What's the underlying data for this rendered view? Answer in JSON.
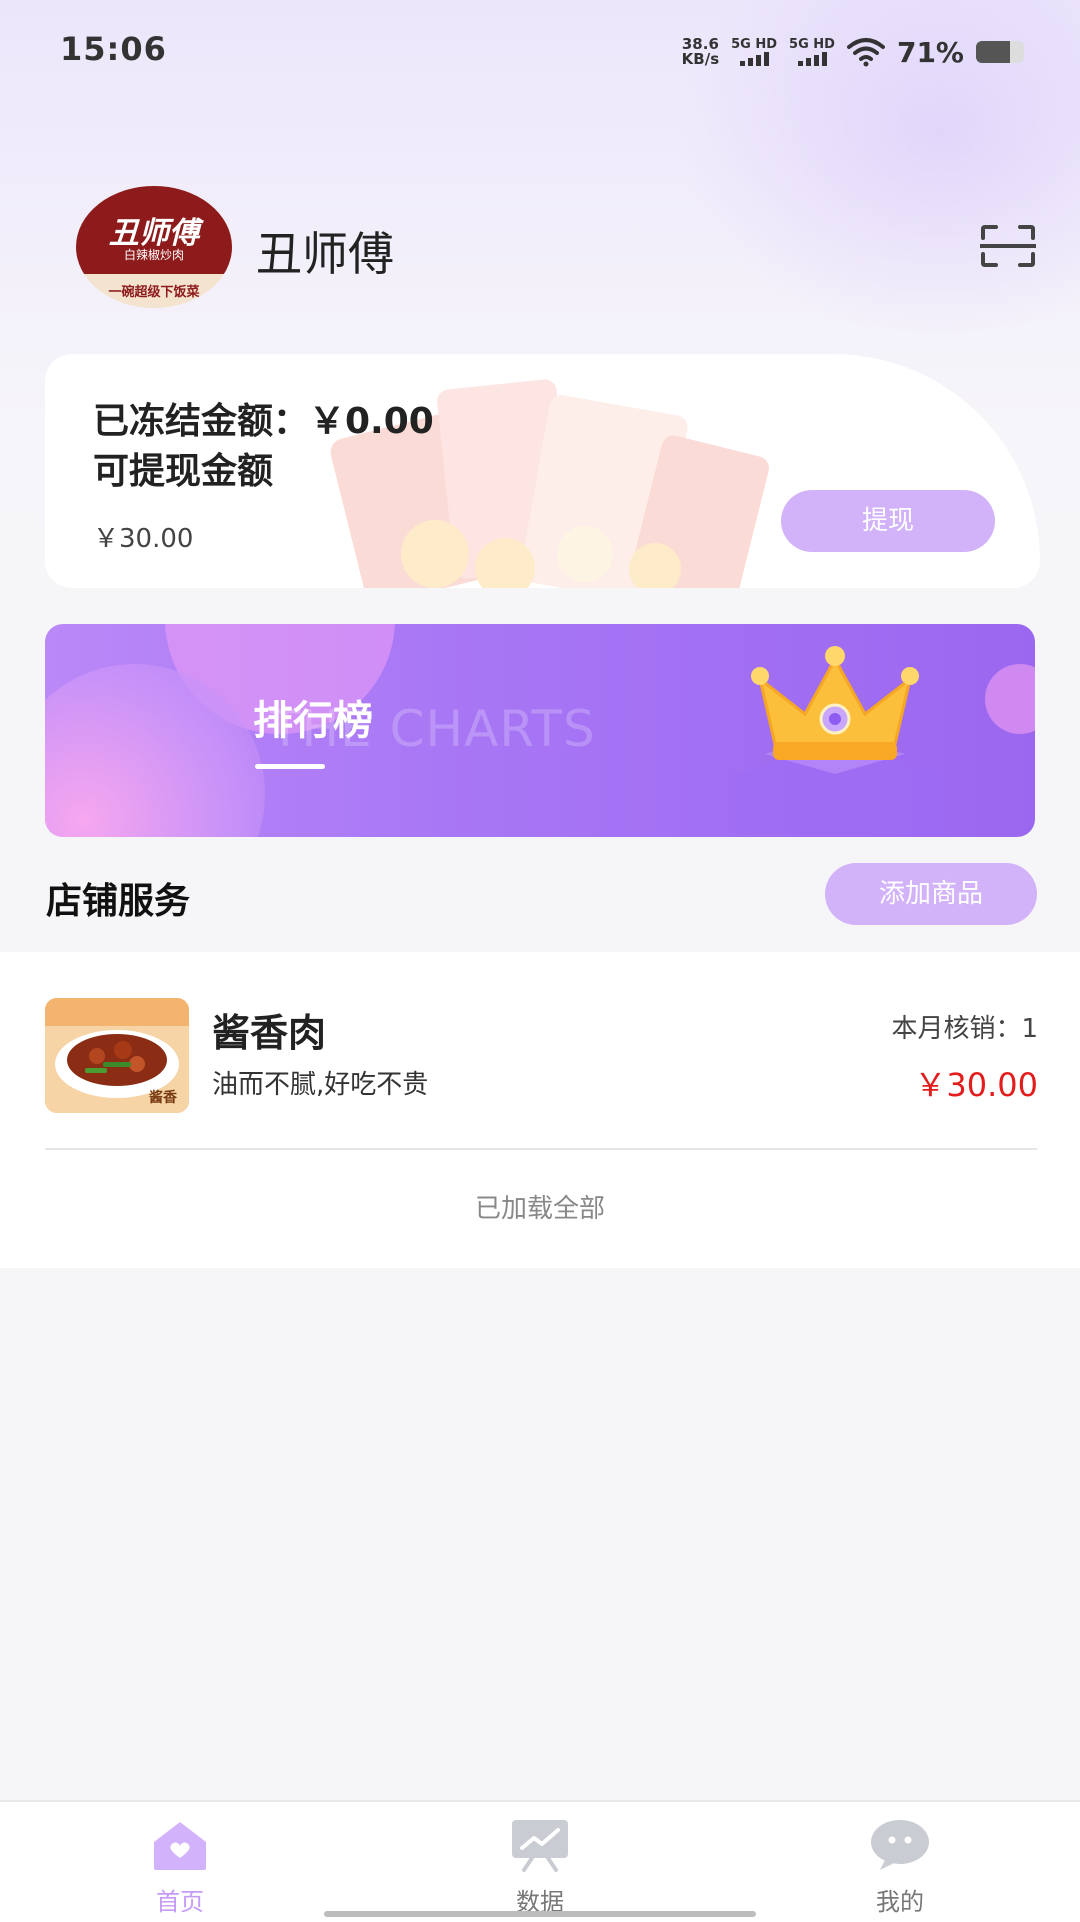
{
  "status_bar": {
    "time": "15:06",
    "net_speed_value": "38.6",
    "net_speed_unit": "KB/s",
    "sim1_label": "5G HD",
    "sim2_label": "5G HD",
    "battery_percent": "71%",
    "battery_level": 0.71
  },
  "header": {
    "shop_name": "丑师傅",
    "avatar_logo_title": "丑师傅",
    "avatar_logo_subtitle": "白辣椒炒肉",
    "avatar_logo_bottom": "一碗超级下饭菜",
    "scan_icon": "scan-icon"
  },
  "balance": {
    "frozen_text": "已冻结金额：￥0.00",
    "withdrawable_label": "可提现金额",
    "withdrawable_amount": "￥30.00",
    "withdraw_button": "提现"
  },
  "charts_banner": {
    "title": "排行榜",
    "subtitle": "THE CHARTS",
    "icon": "crown-icon"
  },
  "store_services": {
    "title": "店铺服务",
    "add_button": "添加商品",
    "products": [
      {
        "name": "酱香肉",
        "description": "油而不腻,好吃不贵",
        "monthly_redeemed": "本月核销：1",
        "price": "￥30.00",
        "thumb_label": "酱香"
      }
    ],
    "footer_text": "已加载全部"
  },
  "bottom_nav": {
    "items": [
      {
        "label": "首页",
        "icon": "home-icon",
        "active": true
      },
      {
        "label": "数据",
        "icon": "chart-board-icon",
        "active": false
      },
      {
        "label": "我的",
        "icon": "profile-bubble-icon",
        "active": false
      }
    ]
  },
  "colors": {
    "accent": "#c59cf8",
    "button": "#d2b3fa",
    "price": "#e31c1c",
    "banner": "#a877f5"
  }
}
